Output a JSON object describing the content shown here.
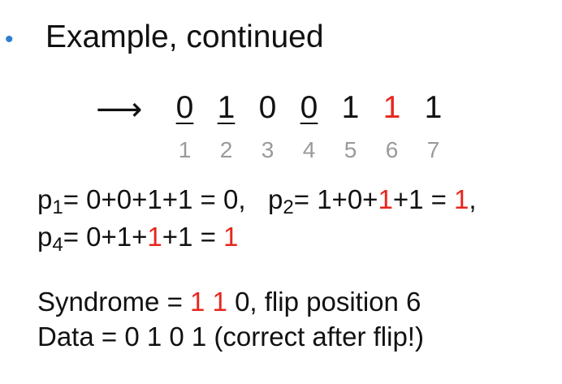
{
  "slide": {
    "bullet": "•",
    "heading": "Example, continued",
    "arrow": "⟶",
    "bits": [
      {
        "value": "0",
        "underline": true,
        "red": false
      },
      {
        "value": "1",
        "underline": true,
        "red": false
      },
      {
        "value": "0",
        "underline": false,
        "red": false
      },
      {
        "value": "0",
        "underline": true,
        "red": false
      },
      {
        "value": "1",
        "underline": false,
        "red": false
      },
      {
        "value": "1",
        "underline": false,
        "red": true
      },
      {
        "value": "1",
        "underline": false,
        "red": false
      }
    ],
    "positions": [
      "1",
      "2",
      "3",
      "4",
      "5",
      "6",
      "7"
    ],
    "p1": {
      "base": "p",
      "sub": "1",
      "expr": "= 0+0+1+1 = 0,"
    },
    "p2": {
      "base": "p",
      "sub": "2",
      "expr_a": "= 1+0+",
      "expr_b": "1",
      "expr_c": "+1 = ",
      "result": "1",
      "tail": ","
    },
    "p4": {
      "base": "p",
      "sub": "4",
      "expr_a": "= 0+1+",
      "expr_b": "1",
      "expr_c": "+1 = ",
      "result": "1"
    },
    "syndrome": {
      "prefix": "Syndrome = ",
      "bit1": "1",
      "bit2": "1",
      "suffix": " 0, flip position 6"
    },
    "data_line": "Data = 0 1 0 1 (correct after flip!)",
    "colors": {
      "red": "#e8261c",
      "bullet": "#2e7dd1",
      "position_gray": "#9a9a9a"
    }
  }
}
